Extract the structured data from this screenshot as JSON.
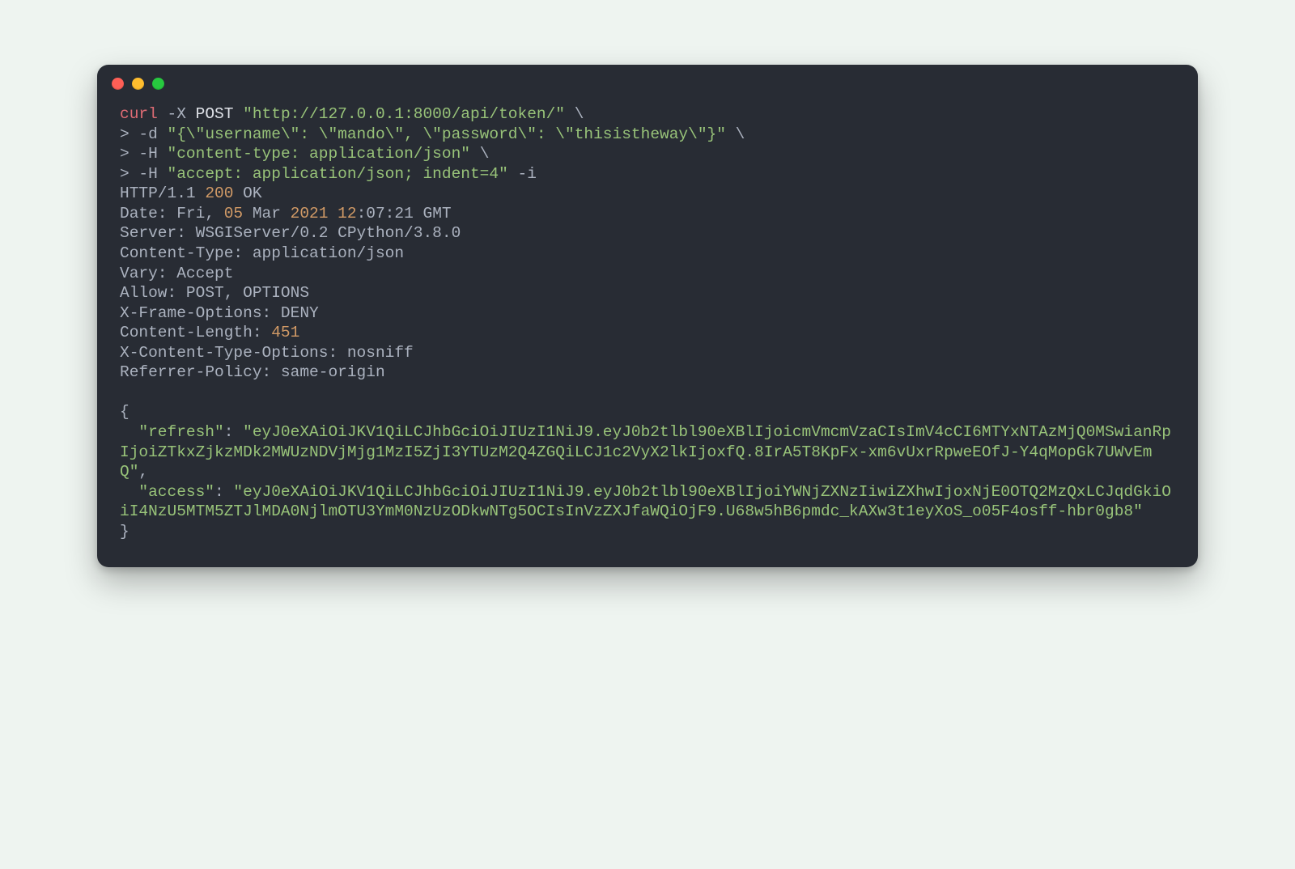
{
  "command": {
    "prog": "curl",
    "method_flag": "-X",
    "method": "POST",
    "url": "\"http://127.0.0.1:8000/api/token/\"",
    "data_flag": "-d",
    "data_value": "\"{\\\"username\\\": \\\"mando\\\", \\\"password\\\": \\\"thisistheway\\\"}\"",
    "header1_flag": "-H",
    "header1_value": "\"content-type: application/json\"",
    "header2_flag": "-H",
    "header2_value": "\"accept: application/json; indent=4\"",
    "include_flag": "-i",
    "continuation": "\\",
    "prompt": ">"
  },
  "response": {
    "status_proto": "HTTP/1.1",
    "status_code": "200",
    "status_text": "OK",
    "date_label": "Date: Fri,",
    "date_day": "05",
    "date_month": "Mar",
    "date_year": "2021",
    "time_hour": "12",
    "time_rest": ":07:21 GMT",
    "server": "Server: WSGIServer/0.2 CPython/3.8.0",
    "content_type": "Content-Type: application/json",
    "vary": "Vary: Accept",
    "allow": "Allow: POST, OPTIONS",
    "x_frame": "X-Frame-Options: DENY",
    "content_length_label": "Content-Length:",
    "content_length_value": "451",
    "x_content_type_opts": "X-Content-Type-Options: nosniff",
    "referrer_policy": "Referrer-Policy: same-origin"
  },
  "body": {
    "open_brace": "{",
    "refresh_key": "\"refresh\"",
    "refresh_colon": ":",
    "refresh_value": "\"eyJ0eXAiOiJKV1QiLCJhbGciOiJIUzI1NiJ9.eyJ0b2tlbl90eXBlIjoicmVmcmVzaCIsImV4cCI6MTYxNTAzMjQ0MSwianRpIjoiZTkxZjkzMDk2MWUzNDVjMjg1MzI5ZjI3YTUzM2Q4ZGQiLCJ1c2VyX2lkIjoxfQ.8IrA5T8KpFx-xm6vUxrRpweEOfJ-Y4qMopGk7UWvEmQ\"",
    "comma": ",",
    "access_key": "\"access\"",
    "access_colon": ":",
    "access_value": "\"eyJ0eXAiOiJKV1QiLCJhbGciOiJIUzI1NiJ9.eyJ0b2tlbl90eXBlIjoiYWNjZXNzIiwiZXhwIjoxNjE0OTQ2MzQxLCJqdGkiOiI4NzU5MTM5ZTJlMDA0NjlmOTU3YmM0NzUzODkwNTg5OCIsInVzZXJfaWQiOjF9.U68w5hB6pmdc_kAXw3t1eyXoS_o05F4osff-hbr0gb8\"",
    "close_brace": "}"
  }
}
